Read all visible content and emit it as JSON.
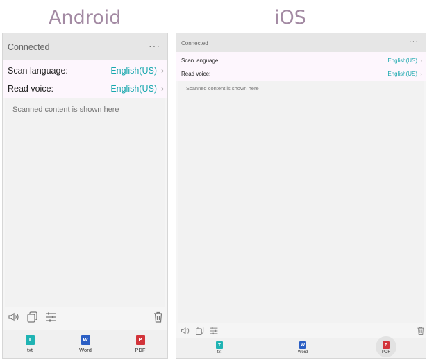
{
  "android": {
    "heading": "Android",
    "header": {
      "title": "Connected",
      "more": "···"
    },
    "settings": [
      {
        "label": "Scan language:",
        "value": "English(US)"
      },
      {
        "label": "Read voice:",
        "value": "English(US)"
      }
    ],
    "content_placeholder": "Scanned content is shown here",
    "tabs": [
      {
        "label": "txt",
        "badge": "T",
        "color": "#1fb3b3"
      },
      {
        "label": "Word",
        "badge": "W",
        "color": "#2b5fc4"
      },
      {
        "label": "PDF",
        "badge": "P",
        "color": "#d2343a"
      }
    ]
  },
  "ios": {
    "heading": "iOS",
    "header": {
      "title": "Connected",
      "more": "···"
    },
    "settings": [
      {
        "label": "Scan language:",
        "value": "English(US)"
      },
      {
        "label": "Read voice:",
        "value": "English(US)"
      }
    ],
    "content_placeholder": "Scanned content is shown here",
    "tabs": [
      {
        "label": "txt",
        "badge": "T",
        "color": "#1fb3b3"
      },
      {
        "label": "Word",
        "badge": "W",
        "color": "#2b5fc4"
      },
      {
        "label": "PDF",
        "badge": "P",
        "color": "#d2343a"
      }
    ]
  },
  "toolbar_icons": [
    "speaker-icon",
    "copy-icon",
    "sliders-icon",
    "trash-icon"
  ],
  "chevron": "›"
}
